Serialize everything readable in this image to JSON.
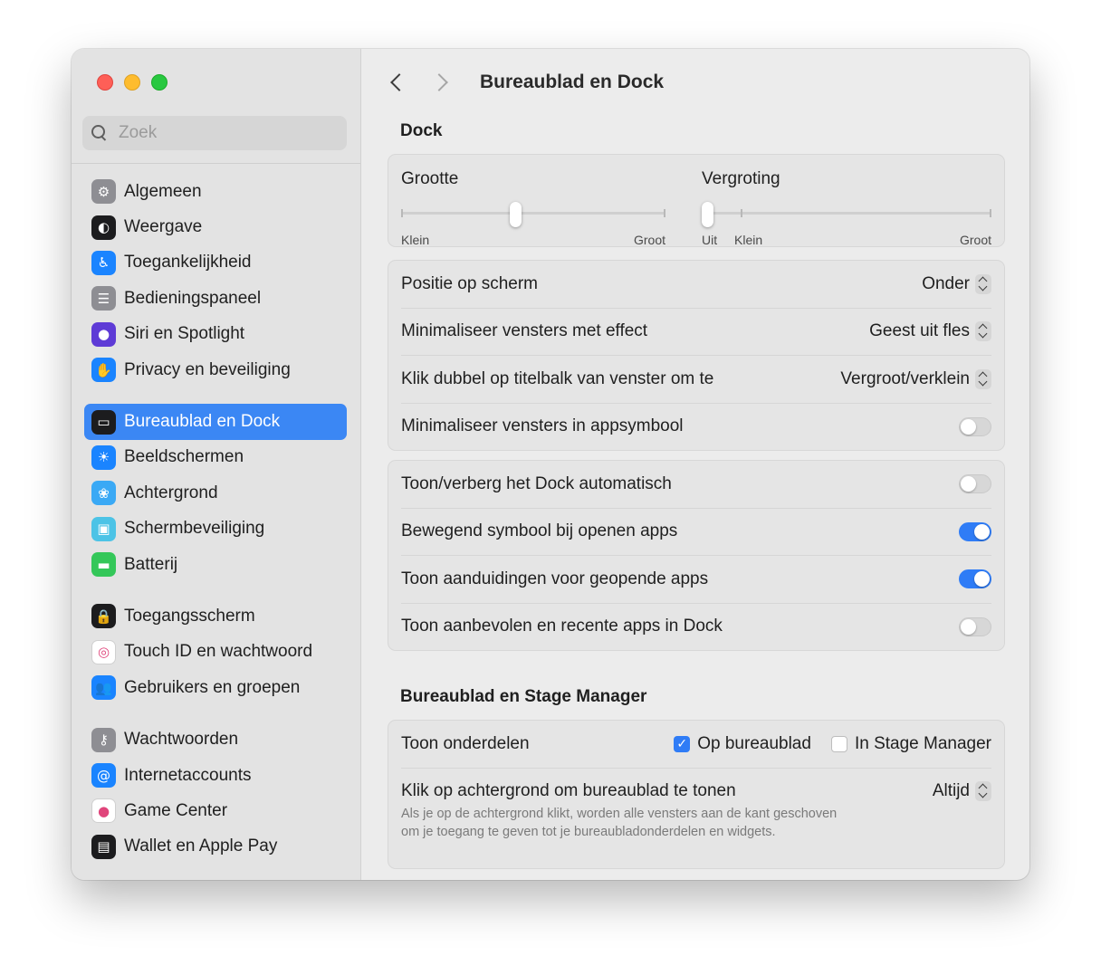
{
  "window": {
    "title": "Bureaublad en Dock"
  },
  "search": {
    "placeholder": "Zoek"
  },
  "sidebar": {
    "groups": [
      [
        {
          "label": "Algemeen",
          "icon": "gear-icon",
          "color": "#8e8e93"
        },
        {
          "label": "Weergave",
          "icon": "appearance-icon",
          "color": "#1c1c1e"
        },
        {
          "label": "Toegankelijkheid",
          "icon": "accessibility-icon",
          "color": "#1a84ff"
        },
        {
          "label": "Bedieningspaneel",
          "icon": "control-center-icon",
          "color": "#8e8e93"
        },
        {
          "label": "Siri en Spotlight",
          "icon": "siri-icon",
          "color": "#5e3bd6"
        },
        {
          "label": "Privacy en beveiliging",
          "icon": "hand-icon",
          "color": "#1a84ff"
        }
      ],
      [
        {
          "label": "Bureaublad en Dock",
          "icon": "dock-icon",
          "color": "#1c1c1e",
          "active": true
        },
        {
          "label": "Beeldschermen",
          "icon": "display-icon",
          "color": "#1a84ff"
        },
        {
          "label": "Achtergrond",
          "icon": "wallpaper-icon",
          "color": "#3aa9f5"
        },
        {
          "label": "Schermbeveiliging",
          "icon": "screensaver-icon",
          "color": "#4cc3e6"
        },
        {
          "label": "Batterij",
          "icon": "battery-icon",
          "color": "#34c759"
        }
      ],
      [
        {
          "label": "Toegangsscherm",
          "icon": "lock-icon",
          "color": "#1c1c1e"
        },
        {
          "label": "Touch ID en wachtwoord",
          "icon": "fingerprint-icon",
          "color": "#ffffff"
        },
        {
          "label": "Gebruikers en groepen",
          "icon": "users-icon",
          "color": "#1a84ff"
        }
      ],
      [
        {
          "label": "Wachtwoorden",
          "icon": "key-icon",
          "color": "#8e8e93"
        },
        {
          "label": "Internetaccounts",
          "icon": "at-icon",
          "color": "#1a84ff"
        },
        {
          "label": "Game Center",
          "icon": "game-center-icon",
          "color": "#ffffff"
        },
        {
          "label": "Wallet en Apple Pay",
          "icon": "wallet-icon",
          "color": "#1c1c1e"
        }
      ]
    ]
  },
  "dock": {
    "section_title": "Dock",
    "size": {
      "label": "Grootte",
      "min_label": "Klein",
      "max_label": "Groot",
      "value": 0.43
    },
    "magnification": {
      "label": "Vergroting",
      "off_label": "Uit",
      "min_label": "Klein",
      "max_label": "Groot",
      "value": 0.0
    },
    "position": {
      "label": "Positie op scherm",
      "value": "Onder"
    },
    "minimize_effect": {
      "label": "Minimaliseer vensters met effect",
      "value": "Geest uit fles"
    },
    "double_click": {
      "label": "Klik dubbel op titelbalk van venster om te",
      "value": "Vergroot/verklein"
    },
    "minimize_into_icon": {
      "label": "Minimaliseer vensters in appsymbool",
      "on": false
    },
    "autohide": {
      "label": "Toon/verberg het Dock automatisch",
      "on": false
    },
    "animate": {
      "label": "Bewegend symbool bij openen apps",
      "on": true
    },
    "indicators": {
      "label": "Toon aanduidingen voor geopende apps",
      "on": true
    },
    "recent_apps": {
      "label": "Toon aanbevolen en recente apps in Dock",
      "on": false
    }
  },
  "stage": {
    "section_title": "Bureaublad en Stage Manager",
    "show_items": {
      "label": "Toon onderdelen",
      "desktop_label": "Op bureaublad",
      "desktop_checked": true,
      "stage_label": "In Stage Manager",
      "stage_checked": false
    },
    "click_wallpaper": {
      "label": "Klik op achtergrond om bureaublad te tonen",
      "value": "Altijd",
      "help": "Als je op de achtergrond klikt, worden alle vensters aan de kant geschoven om je toegang te geven tot je bureaubladonderdelen en widgets."
    }
  }
}
